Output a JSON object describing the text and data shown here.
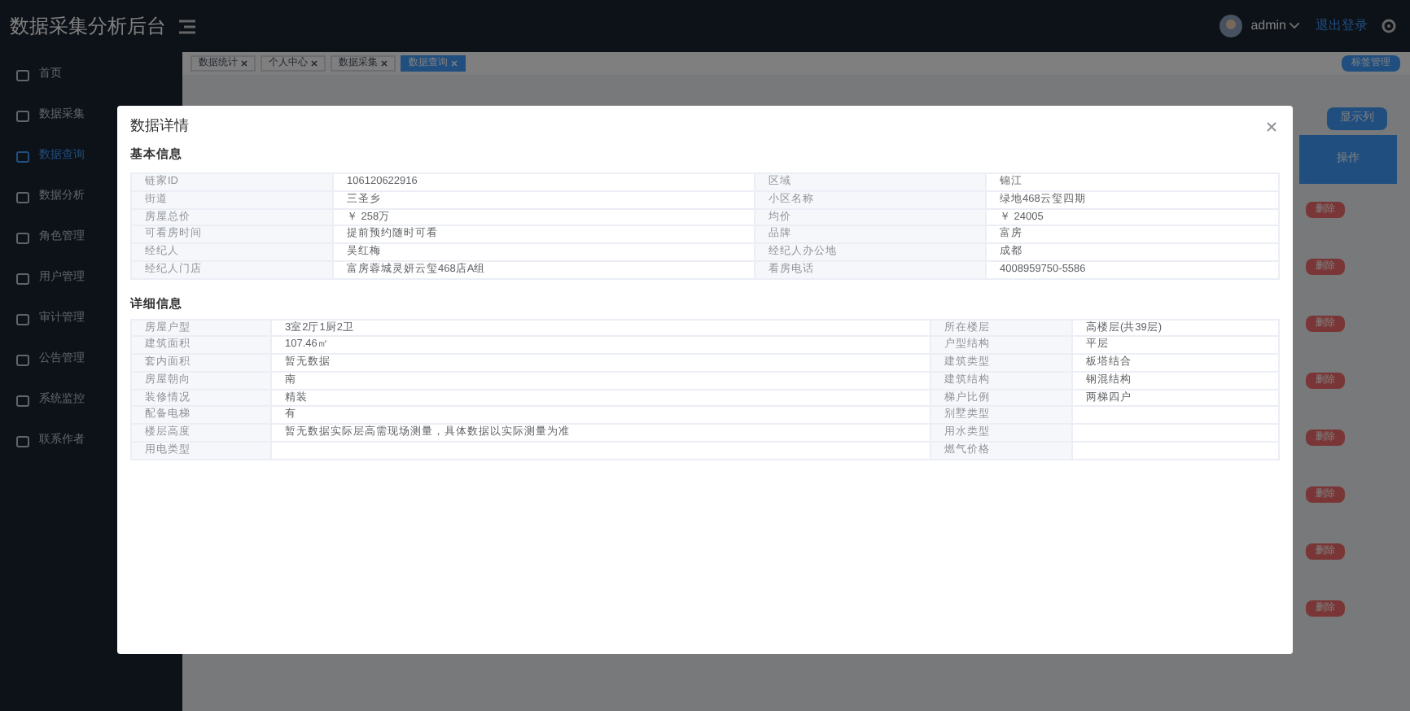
{
  "app": {
    "title": "数据采集分析后台",
    "user": "admin",
    "logout": "退出登录"
  },
  "sidebar": {
    "items": [
      {
        "label": "首页",
        "selected": false
      },
      {
        "label": "数据采集",
        "selected": false
      },
      {
        "label": "数据查询",
        "selected": true
      },
      {
        "label": "数据分析",
        "selected": false
      },
      {
        "label": "角色管理",
        "selected": false
      },
      {
        "label": "用户管理",
        "selected": false
      },
      {
        "label": "审计管理",
        "selected": false
      },
      {
        "label": "公告管理",
        "selected": false
      },
      {
        "label": "系统监控",
        "selected": false
      },
      {
        "label": "联系作者",
        "selected": false
      }
    ]
  },
  "tabs": [
    {
      "label": "数据统计",
      "selected": false
    },
    {
      "label": "个人中心",
      "selected": false
    },
    {
      "label": "数据采集",
      "selected": false
    },
    {
      "label": "数据查询",
      "selected": true
    }
  ],
  "tag_manage": "标签管理",
  "show_columns": "显示列",
  "operation_header": "操作",
  "delete_buttons": [
    "删除",
    "删除",
    "删除",
    "删除",
    "删除",
    "删除",
    "删除",
    "删除"
  ],
  "dialog": {
    "title": "数据详情",
    "basic": {
      "heading": "基本信息",
      "rows": [
        {
          "label1": "链家ID",
          "value1": "106120622916",
          "label2": "区域",
          "value2": "锦江"
        },
        {
          "label1": "街道",
          "value1": "三圣乡",
          "label2": "小区名称",
          "value2": "绿地468云玺四期"
        },
        {
          "label1": "房屋总价",
          "value1": "￥ 258万",
          "label2": "均价",
          "value2": "￥ 24005"
        },
        {
          "label1": "可看房时间",
          "value1": "提前预约随时可看",
          "label2": "品牌",
          "value2": "富房"
        },
        {
          "label1": "经纪人",
          "value1": "吴红梅",
          "label2": "经纪人办公地",
          "value2": "成都"
        },
        {
          "label1": "经纪人门店",
          "value1": "富房蓉城灵妍云玺468店A组",
          "label2": "看房电话",
          "value2": "4008959750-5586"
        }
      ]
    },
    "detail": {
      "heading": "详细信息",
      "rows": [
        {
          "label1": "房屋户型",
          "value1": "3室2厅1厨2卫",
          "label2": "所在楼层",
          "value2": "高楼层(共39层)"
        },
        {
          "label1": "建筑面积",
          "value1": "107.46㎡",
          "label2": "户型结构",
          "value2": "平层"
        },
        {
          "label1": "套内面积",
          "value1": "暂无数据",
          "label2": "建筑类型",
          "value2": "板塔结合"
        },
        {
          "label1": "房屋朝向",
          "value1": "南",
          "label2": "建筑结构",
          "value2": "钢混结构"
        },
        {
          "label1": "装修情况",
          "value1": "精装",
          "label2": "梯户比例",
          "value2": "两梯四户"
        },
        {
          "label1": "配备电梯",
          "value1": "有",
          "label2": "别墅类型"
        },
        {
          "label1": "楼层高度",
          "value1": "暂无数据实际层高需现场测量，具体数据以实际测量为准",
          "label2": "用水类型"
        },
        {
          "label1": "用电类型",
          "label2": "燃气价格"
        }
      ]
    }
  }
}
